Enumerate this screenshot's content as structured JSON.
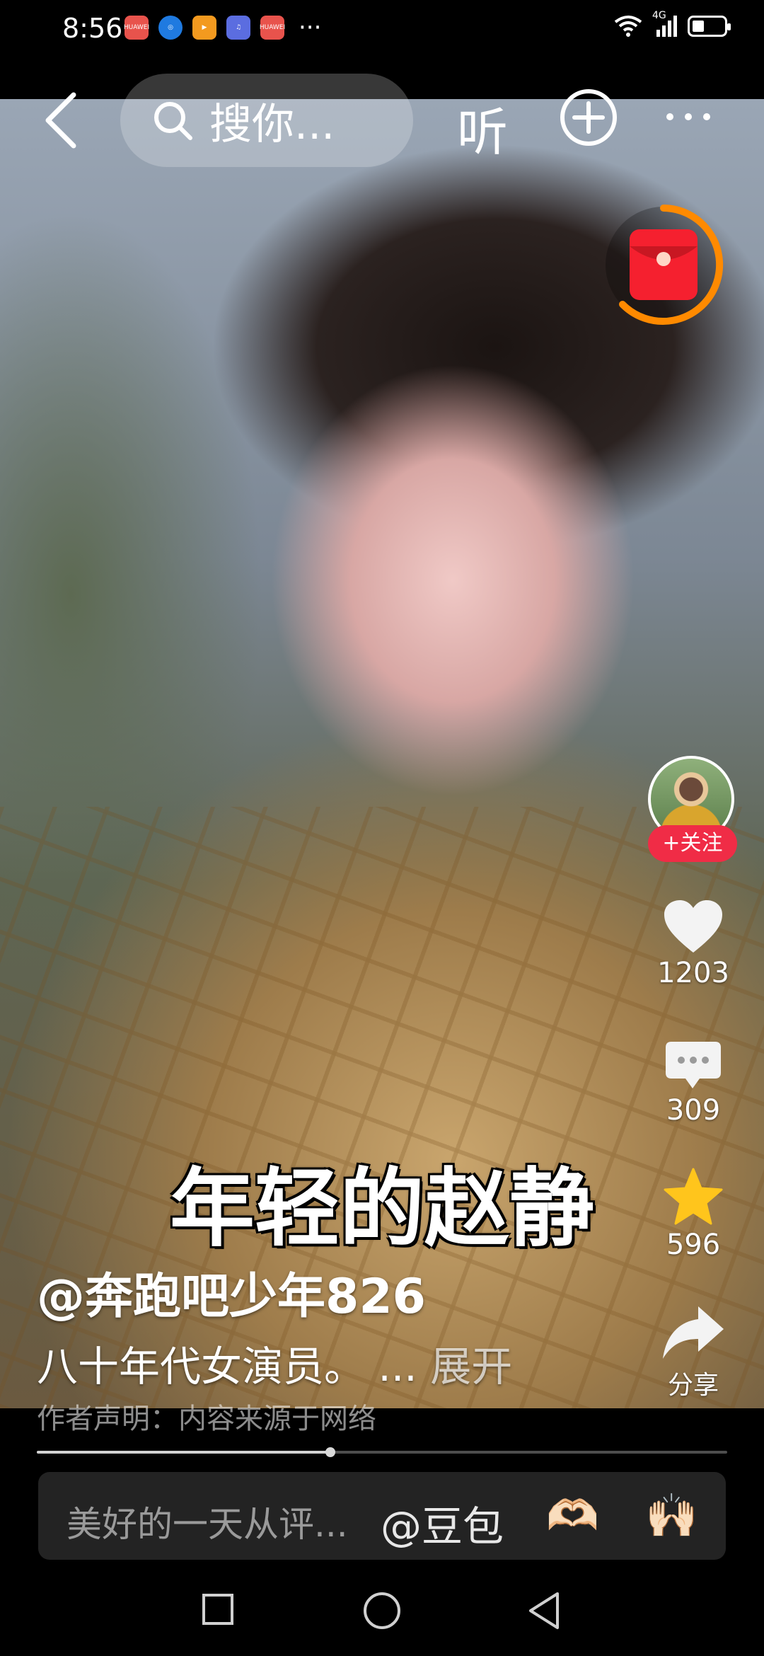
{
  "status_bar": {
    "time": "8:56",
    "notification_icons": [
      {
        "name": "huawei-app-icon",
        "label": "HUAWEI",
        "color": "#e8534c"
      },
      {
        "name": "browser-icon",
        "label": "",
        "color": "#1f7ae0"
      },
      {
        "name": "video-app-icon",
        "label": "",
        "color": "#f39a1f"
      },
      {
        "name": "music-app-icon",
        "label": "",
        "color": "#5b6de0"
      },
      {
        "name": "huawei-app-icon",
        "label": "HUAWEI",
        "color": "#e8534c"
      }
    ],
    "more": "···",
    "network": "4G"
  },
  "top_nav": {
    "search_text": "搜你...",
    "listen_label": "听"
  },
  "video": {
    "caption": "年轻的赵静"
  },
  "right_rail": {
    "follow_label": "+关注",
    "likes": "1203",
    "comments": "309",
    "favorites": "596",
    "share_label": "分享"
  },
  "post": {
    "author": "@奔跑吧少年826",
    "description": "八十年代女演员。 ...",
    "expand_label": "展开",
    "disclaimer": "作者声明：内容来源于网络",
    "progress_fraction": 0.425
  },
  "comment_bar": {
    "placeholder": "美好的一天从评...",
    "mention": "@豆包",
    "emoji_1": "🫶🏻",
    "emoji_2": "🙌🏻"
  },
  "colors": {
    "accent_red": "#f02c46",
    "red_packet_ring": "#ff8a00",
    "star_yellow": "#ffc51c"
  }
}
